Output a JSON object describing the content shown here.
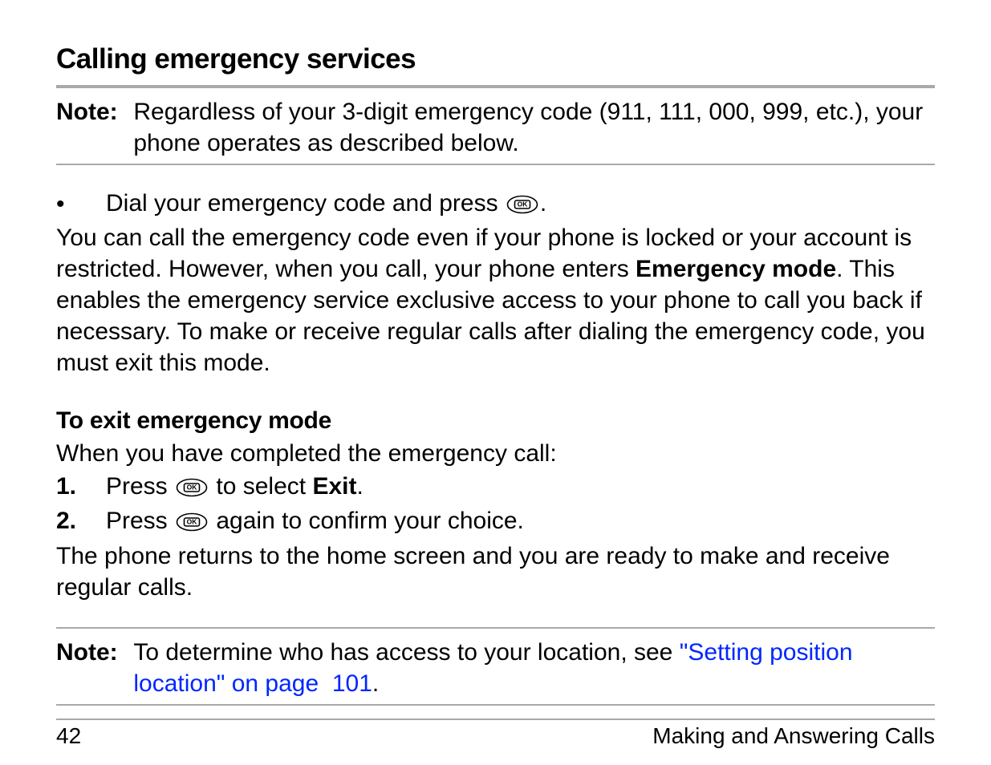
{
  "title": "Calling emergency services",
  "note1": {
    "label": "Note:",
    "body": "Regardless of your 3-digit emergency code (911, 111, 000, 999, etc.), your phone operates as described below."
  },
  "bullet1": {
    "pre": "Dial your emergency code and press ",
    "post": "."
  },
  "para1": {
    "pre": "You can call the emergency code even if your phone is locked or your account is restricted. However, when you call, your phone enters ",
    "bold": "Emergency mode",
    "post": ". This enables the emergency service exclusive access to your phone to call you back if necessary. To make or receive regular calls after dialing the emergency code, you must exit this mode."
  },
  "subhead": "To exit emergency mode",
  "intro2": "When you have completed the emergency call:",
  "steps": [
    {
      "num": "1.",
      "pre": "Press ",
      "mid": " to select ",
      "bold": "Exit",
      "post": "."
    },
    {
      "num": "2.",
      "pre": "Press ",
      "mid": " again to confirm your choice."
    }
  ],
  "para2": "The phone returns to the home screen and you are ready to make and receive regular calls.",
  "note2": {
    "label": "Note:",
    "pre": "To determine who has access to your location, see ",
    "link": "\"Setting position location\" on page  101",
    "post": "."
  },
  "footer": {
    "pageNum": "42",
    "section": "Making and Answering Calls"
  }
}
